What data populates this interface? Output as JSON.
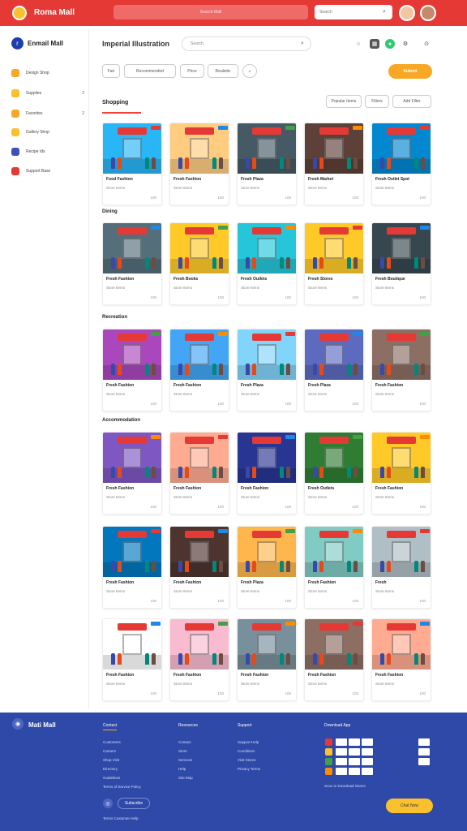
{
  "topbar": {
    "logo": "Roma Mall",
    "search_label": "Search Mall",
    "search_placeholder": "Search"
  },
  "sidebar": {
    "brand": "Enmail Mall",
    "items": [
      {
        "label": "Design Shop",
        "count": ""
      },
      {
        "label": "Supplies",
        "count": "2"
      },
      {
        "label": "Favorites",
        "count": "2"
      },
      {
        "label": "Gallery Shop",
        "count": ""
      },
      {
        "label": "Recipe Ids",
        "count": ""
      },
      {
        "label": "Support Base",
        "count": ""
      }
    ]
  },
  "header": {
    "title": "Imperial Illustration",
    "search_placeholder": "Search",
    "filters": [
      "Fair",
      "Recommended",
      "Price",
      "Realistic"
    ],
    "cta": "Submit"
  },
  "sections": [
    {
      "title": "Shopping",
      "sorts": [
        "Popular Items",
        "Filters",
        "Add Filter"
      ]
    },
    {
      "title": "Dining"
    },
    {
      "title": "Recreation"
    },
    {
      "title": "Accommodation"
    }
  ],
  "cards": [
    {
      "title": "Food Fashion",
      "sub": "Store Items",
      "meta": "100"
    },
    {
      "title": "Fresh Fashion",
      "sub": "Store Items",
      "meta": "100"
    },
    {
      "title": "Fresh Plaza",
      "sub": "Store Items",
      "meta": "100"
    },
    {
      "title": "Fresh Market",
      "sub": "Store Items",
      "meta": "100"
    },
    {
      "title": "Fresh Outlet Spot",
      "sub": "Store Items",
      "meta": "100"
    },
    {
      "title": "Fresh Fashion",
      "sub": "Store Items",
      "meta": "100"
    },
    {
      "title": "Fresh Books",
      "sub": "Store Items",
      "meta": "100"
    },
    {
      "title": "Fresh Outlets",
      "sub": "Store Items",
      "meta": "100"
    },
    {
      "title": "Fresh Stores",
      "sub": "Store Items",
      "meta": "100"
    },
    {
      "title": "Fresh Boutique",
      "sub": "Store Items",
      "meta": "100"
    },
    {
      "title": "Fresh Fashion",
      "sub": "Store Items",
      "meta": "100"
    },
    {
      "title": "Fresh Fashion",
      "sub": "Store Items",
      "meta": "100"
    },
    {
      "title": "Fresh Plaza",
      "sub": "Store Items",
      "meta": "100"
    },
    {
      "title": "Fresh Plaza",
      "sub": "Store Items",
      "meta": "100"
    },
    {
      "title": "Fresh Fashion",
      "sub": "Store Items",
      "meta": "100"
    },
    {
      "title": "Fresh Fashion",
      "sub": "Store Items",
      "meta": "100"
    },
    {
      "title": "Fresh Fashion",
      "sub": "Store Items",
      "meta": "100"
    },
    {
      "title": "Fresh Fashion",
      "sub": "Store Items",
      "meta": "100"
    },
    {
      "title": "Fresh Outlets",
      "sub": "Store Items",
      "meta": "100"
    },
    {
      "title": "Fresh Fashion",
      "sub": "Store Items",
      "meta": "100"
    },
    {
      "title": "Fresh Fashion",
      "sub": "Store Items",
      "meta": "100"
    },
    {
      "title": "Fresh Fashion",
      "sub": "Store Items",
      "meta": "100"
    },
    {
      "title": "Fresh Plaza",
      "sub": "Store Items",
      "meta": "100"
    },
    {
      "title": "Fresh Fashion",
      "sub": "Store Items",
      "meta": "100"
    },
    {
      "title": "Fresh",
      "sub": "Store Items",
      "meta": "100"
    },
    {
      "title": "Fresh Fashion",
      "sub": "Store Items",
      "meta": "100"
    },
    {
      "title": "Fresh Fashion",
      "sub": "Store Items",
      "meta": "100"
    },
    {
      "title": "Fresh Fashion",
      "sub": "Store Items",
      "meta": "100"
    },
    {
      "title": "Fresh Fashion",
      "sub": "Store Items",
      "meta": "100"
    },
    {
      "title": "Fresh Fashion",
      "sub": "Store Items",
      "meta": "100"
    }
  ],
  "footer": {
    "brand": "Mati Mall",
    "col1": {
      "head": "Contact",
      "links": [
        "Customers",
        "Careers",
        "Shop Visit",
        "Directory",
        "Guidelines",
        "Terms of Service Policy"
      ]
    },
    "col2": {
      "head": "Resources",
      "links": [
        "Contact",
        "Store",
        "Services",
        "Help",
        "Site Map"
      ]
    },
    "col3": {
      "head": "Support",
      "links": [
        "Support Help",
        "Conditions",
        "Visit Stores",
        "Privacy Terms"
      ]
    },
    "col4": {
      "head": "Download App",
      "foot": "Scan to Download Stores"
    },
    "social_btn": "Subscribe",
    "bottom": "Terms  Customer Help",
    "chat": "Chat Now"
  },
  "colors": {
    "topbar": "#e53935",
    "footer": "#2f49a8",
    "cta": "#f9a825",
    "accent_underline": "#f44336"
  }
}
